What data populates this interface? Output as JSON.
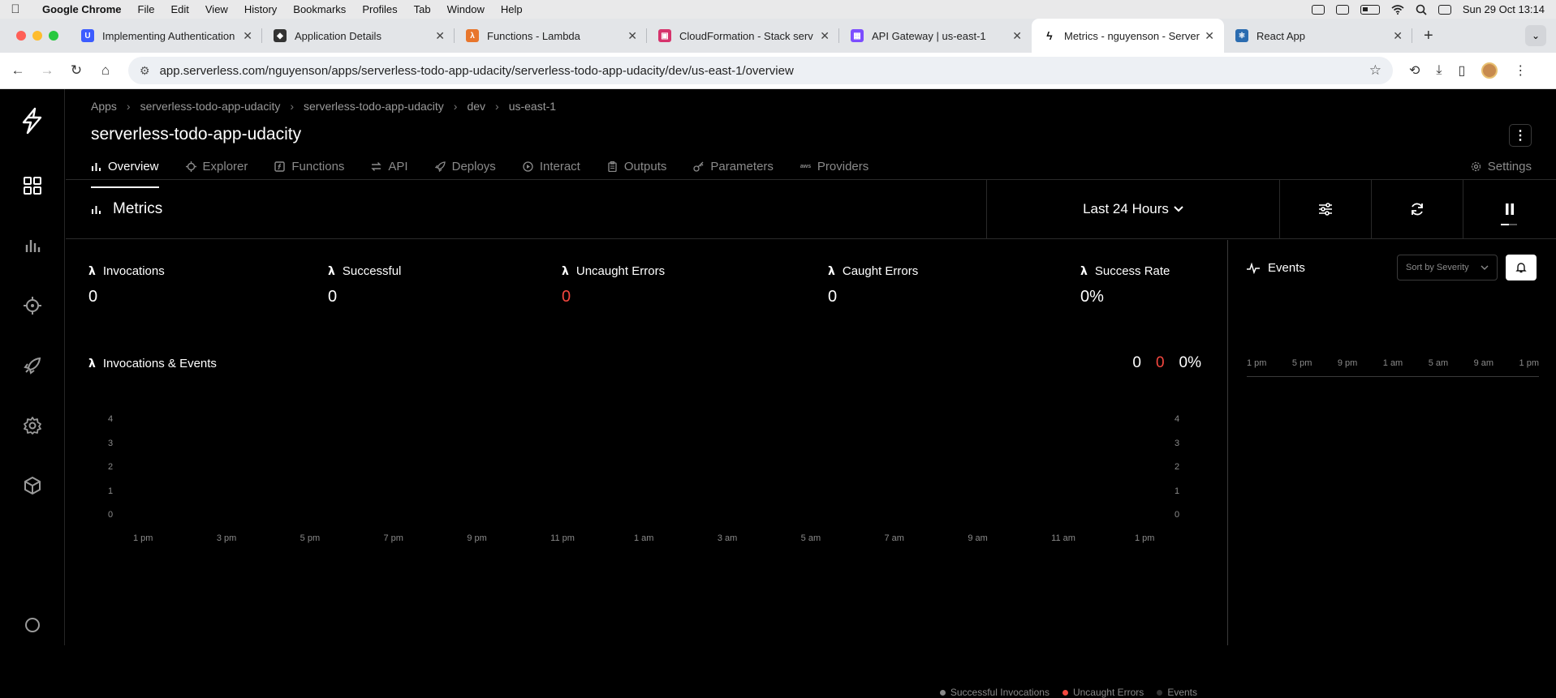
{
  "menubar": {
    "app_name": "Google Chrome",
    "items": [
      "File",
      "Edit",
      "View",
      "History",
      "Bookmarks",
      "Profiles",
      "Tab",
      "Window",
      "Help"
    ],
    "clock": "Sun 29 Oct  13:14"
  },
  "tabs": [
    {
      "title": "Implementing Authentication",
      "icon": "udacity-icon",
      "color": "#3c5cff"
    },
    {
      "title": "Application Details",
      "icon": "shield-icon",
      "color": "#333333"
    },
    {
      "title": "Functions - Lambda",
      "icon": "lambda-icon",
      "color": "#e8762c"
    },
    {
      "title": "CloudFormation - Stack serv",
      "icon": "cloudformation-icon",
      "color": "#d6336c"
    },
    {
      "title": "API Gateway | us-east-1",
      "icon": "apigateway-icon",
      "color": "#7c4dff"
    },
    {
      "title": "Metrics - nguyenson - Server",
      "icon": "serverless-icon",
      "color": "#111111"
    },
    {
      "title": "React App",
      "icon": "react-icon",
      "color": "#2b6cb0"
    }
  ],
  "address_bar": {
    "url": "app.serverless.com/nguyenson/apps/serverless-todo-app-udacity/serverless-todo-app-udacity/dev/us-east-1/overview"
  },
  "breadcrumbs": [
    "Apps",
    "serverless-todo-app-udacity",
    "serverless-todo-app-udacity",
    "dev",
    "us-east-1"
  ],
  "page_title": "serverless-todo-app-udacity",
  "nav_tabs": [
    {
      "label": "Overview",
      "icon": "bar-chart-icon"
    },
    {
      "label": "Explorer",
      "icon": "crosshair-icon"
    },
    {
      "label": "Functions",
      "icon": "function-icon"
    },
    {
      "label": "API",
      "icon": "arrows-icon"
    },
    {
      "label": "Deploys",
      "icon": "rocket-icon"
    },
    {
      "label": "Interact",
      "icon": "play-icon"
    },
    {
      "label": "Outputs",
      "icon": "clipboard-icon"
    },
    {
      "label": "Parameters",
      "icon": "key-icon"
    },
    {
      "label": "Providers",
      "icon": "aws-icon"
    }
  ],
  "settings_label": "Settings",
  "metrics": {
    "title": "Metrics",
    "time_range": "Last 24 Hours"
  },
  "stats": [
    {
      "label": "Invocations",
      "value": "0"
    },
    {
      "label": "Successful",
      "value": "0"
    },
    {
      "label": "Uncaught Errors",
      "value": "0"
    },
    {
      "label": "Caught Errors",
      "value": "0"
    },
    {
      "label": "Success Rate",
      "value": "0%"
    }
  ],
  "invocations_events": {
    "title": "Invocations & Events",
    "totals": [
      "0",
      "0",
      "0%"
    ]
  },
  "chart_data": {
    "type": "bar",
    "x": [
      "1 pm",
      "3 pm",
      "5 pm",
      "7 pm",
      "9 pm",
      "11 pm",
      "1 am",
      "3 am",
      "5 am",
      "7 am",
      "9 am",
      "11 am",
      "1 pm"
    ],
    "yticks": [
      "4",
      "3",
      "2",
      "1",
      "0"
    ],
    "ylim": [
      0,
      4
    ],
    "series": [
      {
        "name": "Successful Invocations",
        "values": [],
        "color": "#888888"
      },
      {
        "name": "Uncaught Errors",
        "values": [],
        "color": "#f5473f"
      },
      {
        "name": "Events",
        "values": [],
        "color": "#333333"
      }
    ],
    "legend_placement": "bottom-right",
    "grid": false
  },
  "events_panel": {
    "title": "Events",
    "sort_label": "Sort by Severity",
    "ticks": [
      "1 pm",
      "5 pm",
      "9 pm",
      "1 am",
      "5 am",
      "9 am",
      "1 pm"
    ]
  },
  "colors": {
    "error": "#f5473f",
    "background": "#000000"
  }
}
